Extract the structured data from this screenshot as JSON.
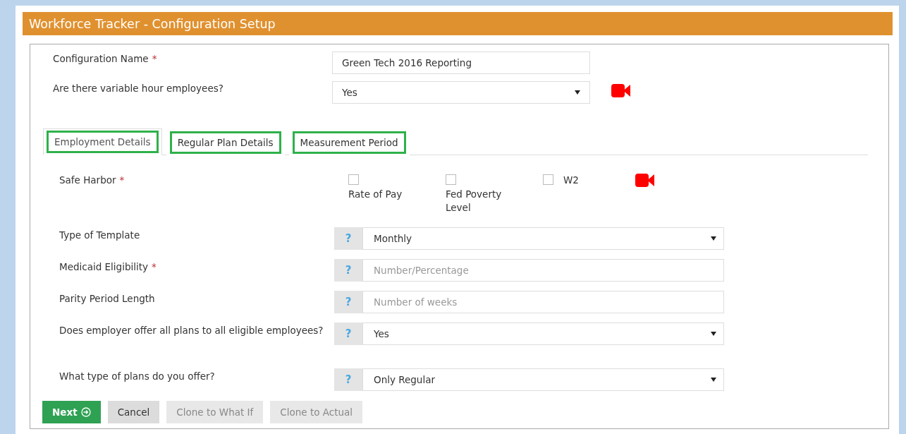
{
  "window": {
    "title": "Workforce Tracker - Configuration Setup"
  },
  "top_fields": [
    {
      "label": "Configuration Name",
      "required_mark": "*",
      "kind": "input",
      "value": "Green Tech 2016 Reporting"
    },
    {
      "label": "Are there variable hour employees?",
      "kind": "select",
      "value": "Yes",
      "video": true
    }
  ],
  "tabs": [
    {
      "label": "Employment Details",
      "selected": true,
      "highlighted": true
    },
    {
      "label": "Regular Plan Details",
      "selected": false,
      "highlighted": true
    },
    {
      "label": "Measurement Period",
      "selected": false,
      "highlighted": true
    }
  ],
  "safe_harbor": {
    "label": "Safe Harbor",
    "required_mark": "*",
    "video": true,
    "options": [
      {
        "label": "Rate of Pay",
        "checked": false,
        "kind": "stacked"
      },
      {
        "label": "Fed Poverty Level",
        "checked": false,
        "kind": "stacked"
      },
      {
        "label": "W2",
        "checked": false,
        "kind": "inline"
      }
    ]
  },
  "fields": [
    {
      "label": "Type of Template",
      "kind": "select",
      "help": "?",
      "value": "Monthly"
    },
    {
      "label": "Medicaid Eligibility",
      "required_mark": "*",
      "kind": "input",
      "help": "?",
      "placeholder": "Number/Percentage"
    },
    {
      "label": "Parity Period Length",
      "kind": "input",
      "help": "?",
      "placeholder": "Number of weeks"
    },
    {
      "label": "Does employer offer all plans to all eligible employees?",
      "kind": "select",
      "help": "?",
      "value": "Yes"
    },
    {
      "label": "What type of plans do you offer?",
      "kind": "select",
      "help": "?",
      "value": "Only Regular"
    }
  ],
  "buttons": [
    {
      "label": "Next",
      "kind": "primary",
      "disabled": false
    },
    {
      "label": "Cancel",
      "kind": "default",
      "disabled": false
    },
    {
      "label": "Clone to What If",
      "kind": "default",
      "disabled": true
    },
    {
      "label": "Clone to Actual",
      "kind": "default",
      "disabled": true
    }
  ]
}
